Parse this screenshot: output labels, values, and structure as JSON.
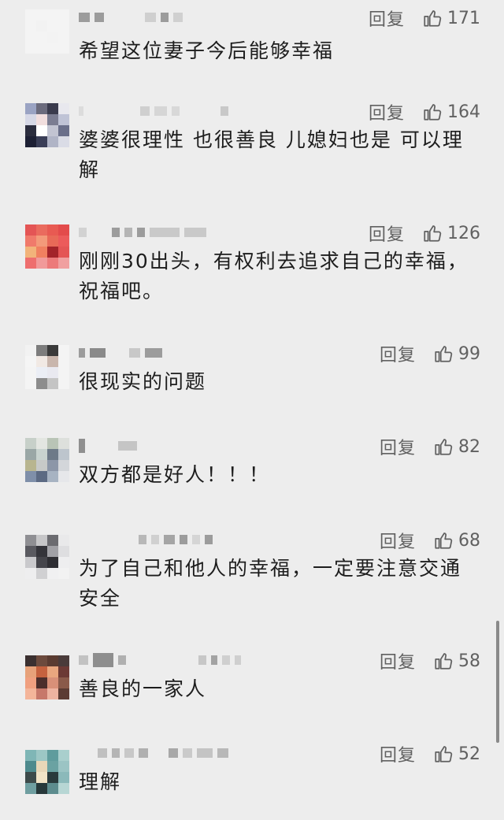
{
  "reply_label": "回复",
  "comments": [
    {
      "text": "希望这位妻子今后能够幸福",
      "likes": "171"
    },
    {
      "text": "婆婆很理性 也很善良 儿媳妇也是 可以理解",
      "likes": "164"
    },
    {
      "text": "刚刚30出头，有权利去追求自己的幸福，祝福吧。",
      "likes": "126"
    },
    {
      "text": "很现实的问题",
      "likes": "99"
    },
    {
      "text": "双方都是好人！！！",
      "likes": "82"
    },
    {
      "text": "为了自己和他人的幸福，一定要注意交通安全",
      "likes": "68"
    },
    {
      "text": "善良的一家人",
      "likes": "58"
    },
    {
      "text": "理解",
      "likes": "52"
    }
  ],
  "icons": {
    "like": "thumbs-up-icon"
  },
  "colors": {
    "background": "#ededed",
    "secondary_text": "#616161"
  }
}
